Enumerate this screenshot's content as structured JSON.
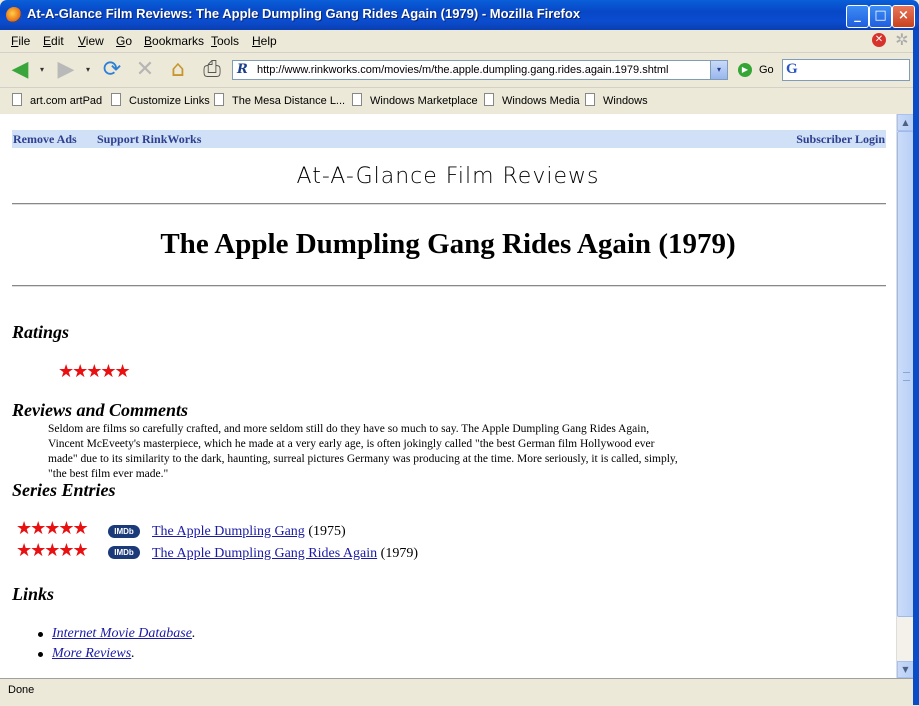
{
  "window": {
    "title": "At-A-Glance Film Reviews: The Apple Dumpling Gang Rides Again (1979) - Mozilla Firefox",
    "minimize": "_",
    "maximize": "□",
    "close": "×"
  },
  "menu": [
    "File",
    "Edit",
    "View",
    "Go",
    "Bookmarks",
    "Tools",
    "Help"
  ],
  "toolbar": {
    "url": "http://www.rinkworks.com/movies/m/the.apple.dumpling.gang.rides.again.1979.shtml",
    "go_label": "Go",
    "search_placeholder": ""
  },
  "icons": {
    "back": "◀",
    "dropdown": "▾",
    "forward": "▶",
    "reload": "⟳",
    "stop": "✕",
    "home": "⌂",
    "print": "⎙",
    "favicon": "R",
    "go": "▶",
    "search": "G",
    "throbber": "✲",
    "stop_small": "✕"
  },
  "bookmarks": [
    "art.com artPad",
    "Customize Links",
    "The Mesa Distance L...",
    "Windows Marketplace",
    "Windows Media",
    "Windows"
  ],
  "page": {
    "nav": {
      "remove_ads": "Remove Ads",
      "support": "Support RinkWorks",
      "login": "Subscriber Login"
    },
    "site_title": "At-A-Glance Film Reviews",
    "film_title": "The Apple Dumpling Gang Rides Again (1979)",
    "ratings_heading": "Ratings",
    "rating_stars": "★★★★★",
    "reviews_heading": "Reviews and Comments",
    "review_text": "Seldom are films so carefully crafted, and more seldom still do they have so much to say. The Apple Dumpling Gang Rides Again, Vincent McEveety's masterpiece, which he made at a very early age, is often jokingly called \"the best German film Hollywood ever made\" due to its similarity to the dark, haunting, surreal pictures Germany was producing at the time. More seriously, it is called, simply, \"the best film ever made.\"",
    "series_heading": "Series Entries",
    "series": [
      {
        "stars": "★★★★★",
        "badge": "IMDb",
        "title": "The Apple Dumpling Gang",
        "year": " (1975)"
      },
      {
        "stars": "★★★★★",
        "badge": "IMDb",
        "title": "The Apple Dumpling Gang Rides Again",
        "year": " (1979)"
      }
    ],
    "links_heading": "Links",
    "links": [
      {
        "text": "Internet Movie Database",
        "suffix": "."
      },
      {
        "text": "More Reviews",
        "suffix": "."
      }
    ]
  },
  "scrollbar": {
    "up": "▲",
    "down": "▼"
  },
  "status": "Done"
}
